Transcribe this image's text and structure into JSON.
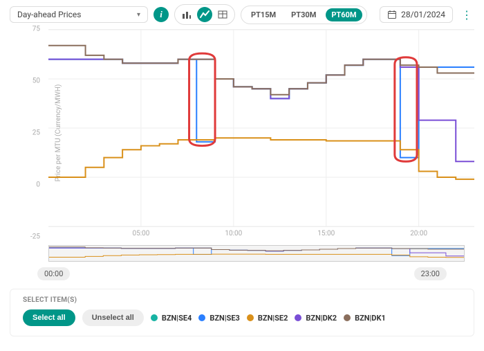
{
  "toolbar": {
    "data_type": "Day-ahead Prices",
    "periods": [
      "PT15M",
      "PT30M",
      "PT60M"
    ],
    "active_period": "PT60M",
    "date": "28/01/2024"
  },
  "chart_data": {
    "type": "line",
    "title": "",
    "xlabel": "",
    "ylabel": "Price per MTU (Currency/MWH)",
    "ylim": [
      -25,
      75
    ],
    "y_ticks": [
      -25,
      0,
      25,
      50,
      75
    ],
    "x_tick_labels": [
      "05:00",
      "10:00",
      "15:00",
      "20:00"
    ],
    "x_tick_positions": [
      5,
      10,
      15,
      20
    ],
    "series": [
      {
        "name": "BZN|SE4",
        "color": "#17b3a3",
        "values": [
          60,
          60,
          60,
          60,
          58,
          58,
          58,
          60,
          60,
          50,
          46,
          45,
          40,
          45,
          48,
          52,
          57,
          60,
          60,
          56,
          56,
          56,
          56,
          56
        ]
      },
      {
        "name": "BZN|SE3",
        "color": "#2a7fff",
        "values": [
          60,
          60,
          60,
          60,
          58,
          58,
          58,
          60,
          18,
          50,
          46,
          45,
          40,
          45,
          48,
          52,
          57,
          60,
          60,
          10,
          56,
          56,
          56,
          56
        ]
      },
      {
        "name": "BZN|SE2",
        "color": "#d9901a",
        "values": [
          0,
          0,
          5,
          10,
          14,
          16,
          17,
          19,
          19,
          20,
          20,
          20,
          19,
          19,
          19,
          18.5,
          18.5,
          18.5,
          18.5,
          14,
          3,
          0,
          -1,
          -1
        ]
      },
      {
        "name": "BZN|DK2",
        "color": "#7a4fd6",
        "values": [
          60,
          60,
          60,
          60,
          58,
          58,
          58,
          60,
          60,
          50,
          46,
          45,
          40,
          45,
          48,
          52,
          57,
          60,
          60,
          56,
          29,
          29,
          8,
          8
        ]
      },
      {
        "name": "BZN|DK1",
        "color": "#8a6e5c",
        "values": [
          67,
          67,
          62,
          60,
          58,
          58,
          58,
          60,
          60,
          50,
          46,
          45,
          42,
          45,
          48,
          52,
          57,
          60,
          60,
          57,
          56,
          53,
          53,
          53
        ]
      }
    ],
    "annotations": [
      {
        "type": "ellipse",
        "x_center_hour": 8.3,
        "width_hours": 1.4,
        "y_top": 63,
        "y_bottom": 16
      },
      {
        "type": "ellipse",
        "x_center_hour": 19.3,
        "width_hours": 1.2,
        "y_top": 61,
        "y_bottom": 8
      }
    ],
    "overview": {
      "start": "00:00",
      "end": "23:00"
    }
  },
  "legend": {
    "heading": "SELECT ITEM(S)",
    "select_all": "Select all",
    "unselect_all": "Unselect all"
  }
}
